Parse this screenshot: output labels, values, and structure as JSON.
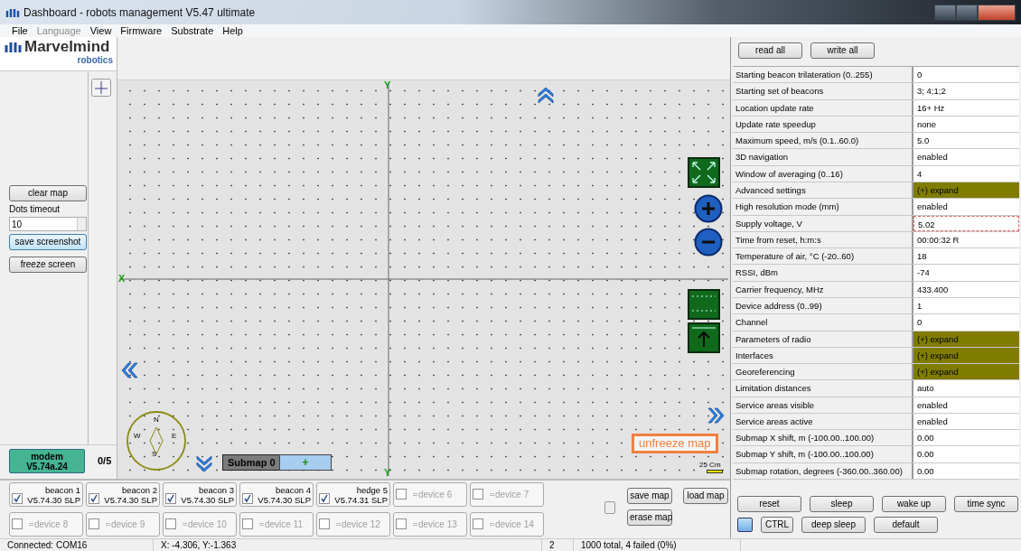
{
  "window": {
    "title": "Dashboard - robots management  V5.47  ultimate"
  },
  "menu": [
    {
      "label": "File",
      "disabled": false
    },
    {
      "label": "Language",
      "disabled": true
    },
    {
      "label": "View",
      "disabled": false
    },
    {
      "label": "Firmware",
      "disabled": false
    },
    {
      "label": "Substrate",
      "disabled": false
    },
    {
      "label": "Help",
      "disabled": false
    }
  ],
  "logo": {
    "name": "Marvelmind",
    "tagline": "robotics"
  },
  "left_panel": {
    "clear_button": "clear map",
    "dots_timeout": {
      "label": "Dots timeout",
      "value": "10"
    },
    "buttons": [
      {
        "label": "save screenshot",
        "focused": true
      },
      {
        "label": "freeze screen",
        "focused": false
      }
    ],
    "modem": {
      "label": "modem",
      "version": "V5.74a.24"
    },
    "count": "0/5"
  },
  "map": {
    "y_axis_top": "Y",
    "y_axis_bottom": "Y",
    "x_axis": "X",
    "compass": [
      "N",
      "W",
      "E",
      "S"
    ],
    "submap": {
      "label": "Submap 0",
      "add": "+"
    },
    "unfreeze": "unfreeze map",
    "scale": "25 Cm"
  },
  "devices": [
    {
      "name": "beacon 1",
      "version": "V5.74.30 SLP",
      "checked": true,
      "active": true
    },
    {
      "name": "beacon 2",
      "version": "V5.74.30 SLP",
      "checked": true,
      "active": true
    },
    {
      "name": "beacon 3",
      "version": "V5.74.30 SLP",
      "checked": true,
      "active": true
    },
    {
      "name": "beacon 4",
      "version": "V5.74.30 SLP",
      "checked": true,
      "active": true
    },
    {
      "name": "hedge 5",
      "version": "V5.74.31 SLP",
      "checked": true,
      "active": true
    },
    {
      "name": "device 6",
      "checked": false,
      "active": false
    },
    {
      "name": "device 7",
      "checked": false,
      "active": false
    },
    {
      "name": "device 8",
      "checked": false,
      "active": false
    },
    {
      "name": "device 9",
      "checked": false,
      "active": false
    },
    {
      "name": "device 10",
      "checked": false,
      "active": false
    },
    {
      "name": "device 11",
      "checked": false,
      "active": false
    },
    {
      "name": "device 12",
      "checked": false,
      "active": false
    },
    {
      "name": "device 13",
      "checked": false,
      "active": false
    },
    {
      "name": "device 14",
      "checked": false,
      "active": false
    }
  ],
  "map_buttons": [
    "save map",
    "load map",
    "erase map"
  ],
  "settings": {
    "buttons": [
      "read all",
      "write all"
    ],
    "rows": [
      {
        "label": "Starting beacon trilateration (0..255)",
        "value": "0",
        "kind": "value"
      },
      {
        "label": "Starting set of beacons",
        "value": "3;  4;1;2",
        "kind": "value"
      },
      {
        "label": "Location update rate",
        "value": "16+ Hz",
        "kind": "value"
      },
      {
        "label": "Update rate speedup",
        "value": "none",
        "kind": "value"
      },
      {
        "label": "Maximum speed, m/s (0.1..60.0)",
        "value": "5.0",
        "kind": "value"
      },
      {
        "label": "3D navigation",
        "value": "enabled",
        "kind": "value"
      },
      {
        "label": "Window of averaging (0..16)",
        "value": "4",
        "kind": "value"
      },
      {
        "label": "Advanced settings",
        "value": "(+) expand",
        "kind": "expand"
      },
      {
        "label": "High resolution mode (mm)",
        "value": "enabled",
        "kind": "value"
      },
      {
        "label": "Supply voltage, V",
        "value": "5.02",
        "kind": "invalid"
      },
      {
        "label": "Time from reset, h:m:s",
        "value": "00:00:32   R",
        "kind": "value"
      },
      {
        "label": "Temperature of air, °C (-20..60)",
        "value": "18",
        "kind": "value"
      },
      {
        "label": "RSSI, dBm",
        "value": "-74",
        "kind": "value"
      },
      {
        "label": "Carrier frequency, MHz",
        "value": "433.400",
        "kind": "value"
      },
      {
        "label": "Device address (0..99)",
        "value": "1",
        "kind": "value"
      },
      {
        "label": "Channel",
        "value": "0",
        "kind": "value"
      },
      {
        "label": "Parameters of radio",
        "value": "(+) expand",
        "kind": "expand"
      },
      {
        "label": "Interfaces",
        "value": "(+) expand",
        "kind": "expand"
      },
      {
        "label": "Georeferencing",
        "value": "(+) expand",
        "kind": "expand"
      },
      {
        "label": "Limitation distances",
        "value": "auto",
        "kind": "value"
      },
      {
        "label": "Service areas visible",
        "value": "enabled",
        "kind": "value"
      },
      {
        "label": "Service areas active",
        "value": "enabled",
        "kind": "value"
      },
      {
        "label": "Submap X shift, m (-100.00..100.00)",
        "value": "0.00",
        "kind": "value"
      },
      {
        "label": "Submap Y shift, m (-100.00..100.00)",
        "value": "0.00",
        "kind": "value"
      },
      {
        "label": "Submap rotation, degrees (-360.00..360.00)",
        "value": "0.00",
        "kind": "value"
      }
    ]
  },
  "device_controls": [
    [
      {
        "kind": "button",
        "label": "reset"
      },
      {
        "kind": "button",
        "label": "sleep"
      },
      {
        "kind": "button",
        "label": "wake up"
      },
      {
        "kind": "button",
        "label": "time sync"
      }
    ],
    [
      {
        "kind": "indicator"
      },
      {
        "kind": "button",
        "label": "CTRL"
      },
      {
        "kind": "button",
        "label": "deep sleep"
      },
      {
        "kind": "button",
        "label": "default"
      }
    ]
  ],
  "status_bar": [
    "Connected: COM16",
    "X: -4.306, Y:-1.363",
    "2",
    "1000 total, 4 failed (0%)"
  ]
}
